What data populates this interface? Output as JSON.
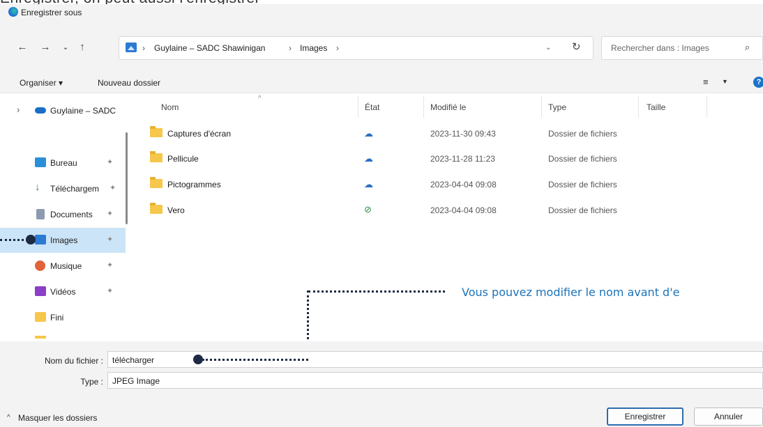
{
  "header": {
    "cropped_text": "Enregistrer, on peut aussi l'enregistrer"
  },
  "window": {
    "title": "Enregistrer sous"
  },
  "nav": {
    "breadcrumb": [
      "Guylaine – SADC Shawinigan",
      "Images"
    ],
    "search_placeholder": "Rechercher dans : Images"
  },
  "toolbar": {
    "organize": "Organiser ▾",
    "new_folder": "Nouveau dossier"
  },
  "sidebar": {
    "items": [
      {
        "label": "Guylaine – SADC"
      },
      {
        "label": "Bureau"
      },
      {
        "label": "Téléchargem"
      },
      {
        "label": "Documents"
      },
      {
        "label": "Images"
      },
      {
        "label": "Musique"
      },
      {
        "label": "Vidéos"
      },
      {
        "label": "Fini"
      }
    ]
  },
  "columns": {
    "name": "Nom",
    "state": "État",
    "modified": "Modifié le",
    "type": "Type",
    "size": "Taille"
  },
  "files": [
    {
      "name": "Captures d'écran",
      "state": "cloud",
      "modified": "2023-11-30 09:43",
      "type": "Dossier de fichiers"
    },
    {
      "name": "Pellicule",
      "state": "cloud",
      "modified": "2023-11-28 11:23",
      "type": "Dossier de fichiers"
    },
    {
      "name": "Pictogrammes",
      "state": "cloud",
      "modified": "2023-04-04 09:08",
      "type": "Dossier de fichiers"
    },
    {
      "name": "Vero",
      "state": "synced",
      "modified": "2023-04-04 09:08",
      "type": "Dossier de fichiers"
    }
  ],
  "annotation": {
    "text": "Vous pouvez modifier le nom avant d'e"
  },
  "form": {
    "filename_label": "Nom du fichier :",
    "filename_value": "télécharger",
    "type_label": "Type :",
    "type_value": "JPEG Image"
  },
  "footer": {
    "hide_folders": "Masquer les dossiers",
    "save": "Enregistrer",
    "cancel": "Annuler"
  },
  "colors": {
    "accent": "#1e73b9",
    "selected": "#cce4f7",
    "folder": "#f6c74b"
  }
}
